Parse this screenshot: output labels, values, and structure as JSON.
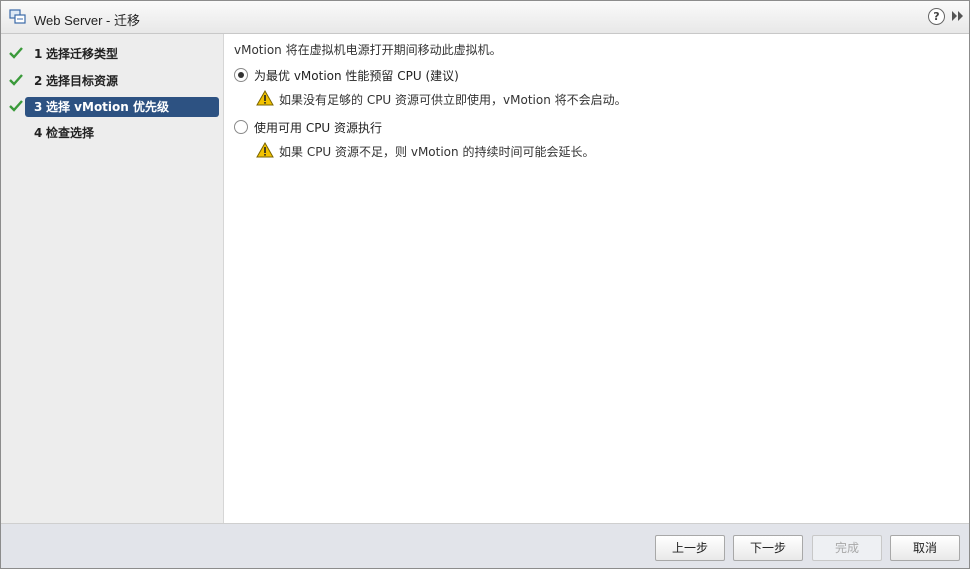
{
  "window": {
    "title": "Web Server - 迁移",
    "app_icon": "vm-migrate-icon"
  },
  "titlebar_buttons": {
    "help": "?",
    "expand_icon": "double-chevron-right-icon"
  },
  "steps": [
    {
      "num": "1",
      "label": "选择迁移类型",
      "completed": true
    },
    {
      "num": "2",
      "label": "选择目标资源",
      "completed": true
    },
    {
      "num": "3",
      "label": "选择 vMotion 优先级",
      "completed": true,
      "active": true
    },
    {
      "num": "4",
      "label": "检查选择",
      "completed": false
    }
  ],
  "content": {
    "intro": "vMotion 将在虚拟机电源打开期间移动此虚拟机。",
    "options": [
      {
        "label": "为最优 vMotion 性能预留 CPU (建议)",
        "selected": true,
        "warning": "如果没有足够的 CPU 资源可供立即使用，vMotion 将不会启动。"
      },
      {
        "label": "使用可用 CPU 资源执行",
        "selected": false,
        "warning": "如果 CPU 资源不足，则 vMotion 的持续时间可能会延长。"
      }
    ]
  },
  "footer": {
    "back": "上一步",
    "next": "下一步",
    "finish": "完成",
    "finish_enabled": false,
    "cancel": "取消"
  },
  "colors": {
    "active_step_bg": "#2d5282",
    "check_green": "#3a9a3a",
    "warning_yellow": "#f2c200"
  }
}
